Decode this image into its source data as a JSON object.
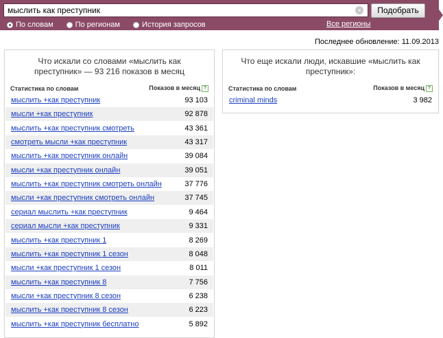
{
  "search": {
    "query": "мыслить как преступник",
    "submit_label": "Подобрать",
    "clear_icon": "×"
  },
  "tabs": [
    {
      "label": "По словам",
      "checked": true
    },
    {
      "label": "По регионам",
      "checked": false
    },
    {
      "label": "История запросов",
      "checked": false
    }
  ],
  "regions_link": "Все регионы",
  "last_updated": "Последнее обновление: 11.09.2013",
  "left_panel": {
    "title_line1": "Что искали со словами «мыслить как",
    "title_line2": "преступник» — 93 216 показов в месяц",
    "col_phrase": "Статистика по словам",
    "col_impressions": "Показов в месяц",
    "help": "?",
    "rows": [
      {
        "phrase": "мыслить +как преступник",
        "count": "93 103"
      },
      {
        "phrase": "мысли +как преступник",
        "count": "92 878"
      },
      {
        "phrase": "мыслить +как преступник смотреть",
        "count": "43 361"
      },
      {
        "phrase": "смотреть мысли +как преступник",
        "count": "43 317"
      },
      {
        "phrase": "мыслить +как преступник онлайн",
        "count": "39 084"
      },
      {
        "phrase": "мысли +как преступник онлайн",
        "count": "39 051"
      },
      {
        "phrase": "мыслить +как преступник смотреть онлайн",
        "count": "37 776"
      },
      {
        "phrase": "мысли +как преступник смотреть онлайн",
        "count": "37 745"
      },
      {
        "phrase": "сериал мыслить +как преступник",
        "count": "9 464"
      },
      {
        "phrase": "сериал мысли +как преступник",
        "count": "9 331"
      },
      {
        "phrase": "мыслить +как преступник 1",
        "count": "8 269"
      },
      {
        "phrase": "мыслить +как преступник 1 сезон",
        "count": "8 048"
      },
      {
        "phrase": "мысли +как преступник 1 сезон",
        "count": "8 011"
      },
      {
        "phrase": "мыслить +как преступник 8",
        "count": "7 756"
      },
      {
        "phrase": "мысли +как преступник 8 сезон",
        "count": "6 238"
      },
      {
        "phrase": "мыслить +как преступник 8 сезон",
        "count": "6 223"
      },
      {
        "phrase": "мыслить +как преступник бесплатно",
        "count": "5 892"
      }
    ]
  },
  "right_panel": {
    "title_line1": "Что еще искали люди, искавшие «мыслить как",
    "title_line2": "преступник»:",
    "col_phrase": "Статистика по словам",
    "col_impressions": "Показов в месяц",
    "help": "?",
    "rows": [
      {
        "phrase": "criminal minds",
        "count": "3 982"
      }
    ]
  }
}
